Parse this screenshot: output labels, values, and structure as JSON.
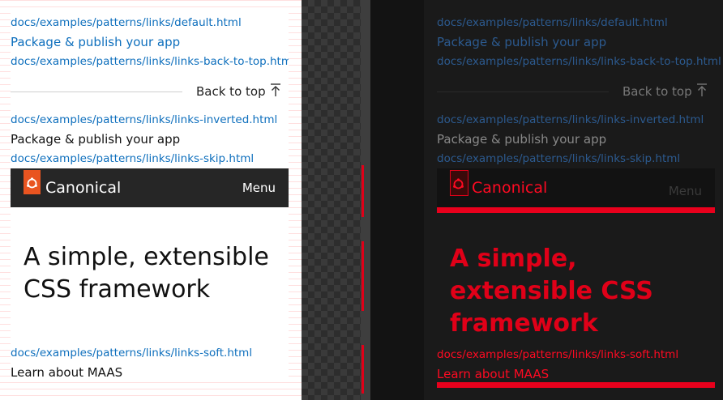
{
  "left": {
    "links": [
      "docs/examples/patterns/links/default.html",
      "Package & publish your app",
      "docs/examples/patterns/links/links-back-to-top.html",
      "docs/examples/patterns/links/links-inverted.html",
      "Package & publish your app",
      "docs/examples/patterns/links/links-skip.html",
      "docs/examples/patterns/links/links-soft.html",
      "Learn about MAAS"
    ],
    "back_to_top": "Back to top",
    "navbar": {
      "brand": "Canonical",
      "menu": "Menu"
    },
    "hero": "A simple, extensible CSS framework"
  },
  "right": {
    "links": [
      "docs/examples/patterns/links/default.html",
      "Package & publish your app",
      "docs/examples/patterns/links/links-back-to-top.html",
      "docs/examples/patterns/links/links-inverted.html",
      "Package & publish your app",
      "docs/examples/patterns/links/links-skip.html",
      "docs/examples/patterns/links/links-soft.html",
      "Learn about MAAS"
    ],
    "back_to_top": "Back to top",
    "navbar": {
      "brand": "Canonical",
      "menu": "Menu"
    },
    "hero": "A simple, extensible CSS framework"
  },
  "colors": {
    "link": "#0e6fbd",
    "navbar_bg": "#262626",
    "brand_orange": "#e95420",
    "diff_red": "#e00018"
  },
  "icons": [
    "arrow-up-to-top-icon",
    "canonical-logo-icon"
  ]
}
